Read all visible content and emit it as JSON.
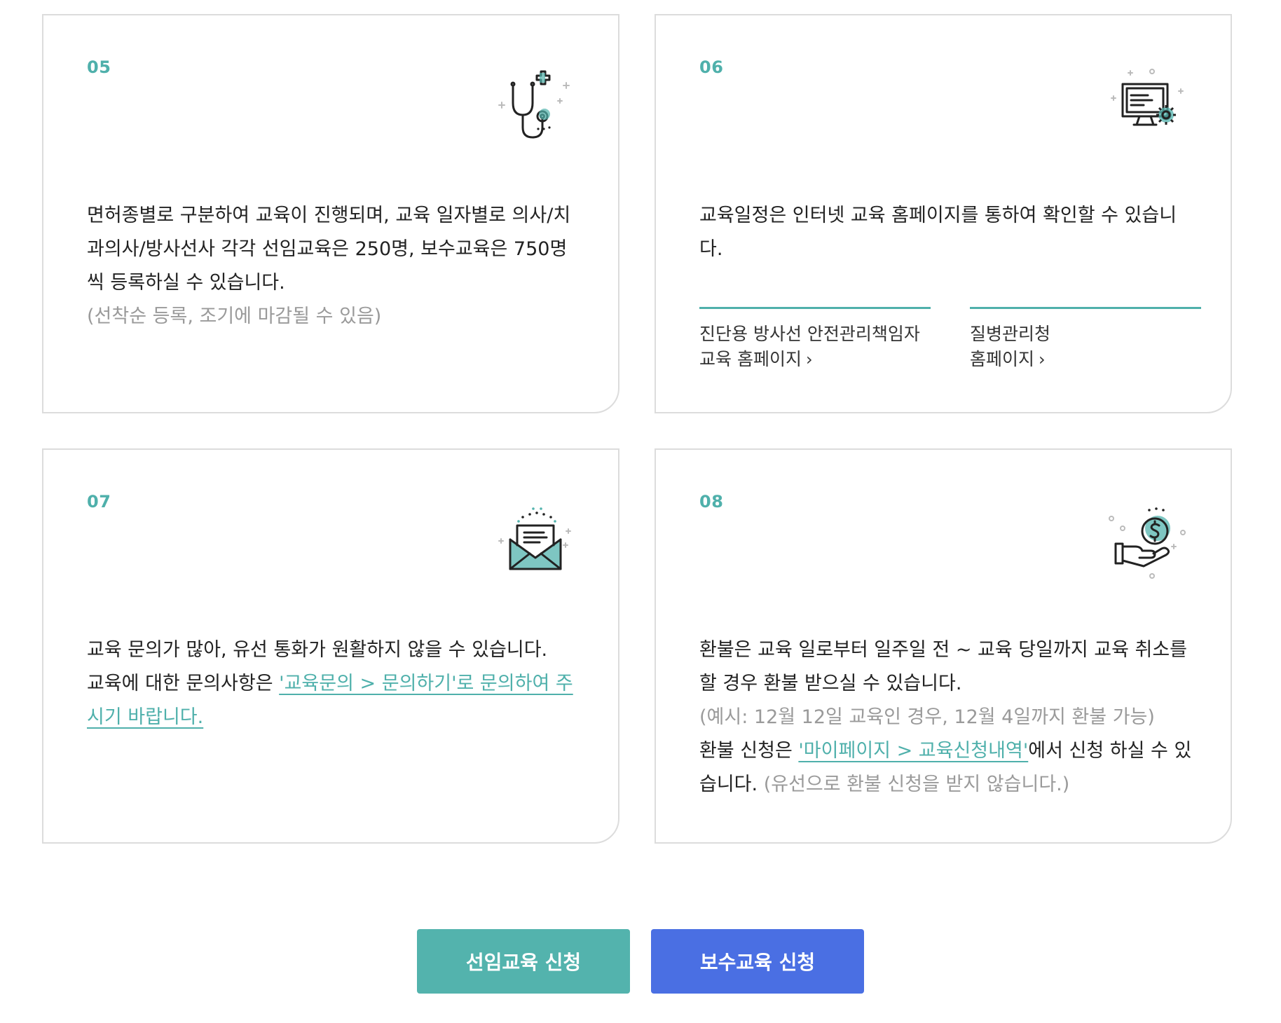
{
  "colors": {
    "accent_green": "#53b3ad",
    "accent_blue": "#4a6fe3",
    "muted_text": "#9a9a9a"
  },
  "cards": [
    {
      "number": "05",
      "icon": "stethoscope-icon",
      "lines": [
        "면허종별로 구분하여 교육이 진행되며, 교육 일자별로 의사/치",
        "과의사/방사선사 각각 선임교육은 250명, 보수교육은 750명",
        "씩 등록하실 수 있습니다."
      ],
      "note": "(선착순 등록, 조기에 마감될 수 있음)"
    },
    {
      "number": "06",
      "icon": "monitor-gear-icon",
      "lines": [
        "교육일정은 인터넷 교육 홈페이지를 통하여 확인할 수 있습니",
        "다."
      ],
      "links": [
        {
          "line1": "진단용 방사선 안전관리책임자",
          "line2": "교육 홈페이지"
        },
        {
          "line1": "질병관리청",
          "line2": "홈페이지"
        }
      ]
    },
    {
      "number": "07",
      "icon": "envelope-letter-icon",
      "line1": "교육 문의가 많아, 유선 통화가 원활하지 않을 수 있습니다.",
      "line2_prefix": "교육에 대한 문의사항은 ",
      "link_line2": "'교육문의 > 문의하기'로 문의하여 주",
      "link_line3": "시기 바랍니다."
    },
    {
      "number": "08",
      "icon": "hand-coin-icon",
      "line1": "환불은 교육 일로부터 일주일 전 ~ 교육 당일까지 교육 취소를",
      "line2": "할 경우 환불 받으실 수 있습니다.",
      "note1": "(예시: 12월 12일 교육인 경우, 12월 4일까지 환불 가능)",
      "line4_prefix": "환불 신청은 ",
      "line4_link": "'마이페이지 > 교육신청내역'",
      "line4_suffix": "에서 신청 하실 수 있",
      "line5": "습니다.",
      "note2": " (유선으로 환불 신청을 받지 않습니다.)"
    }
  ],
  "buttons": {
    "initial_label": "선임교육 신청",
    "refresher_label": "보수교육 신청"
  }
}
